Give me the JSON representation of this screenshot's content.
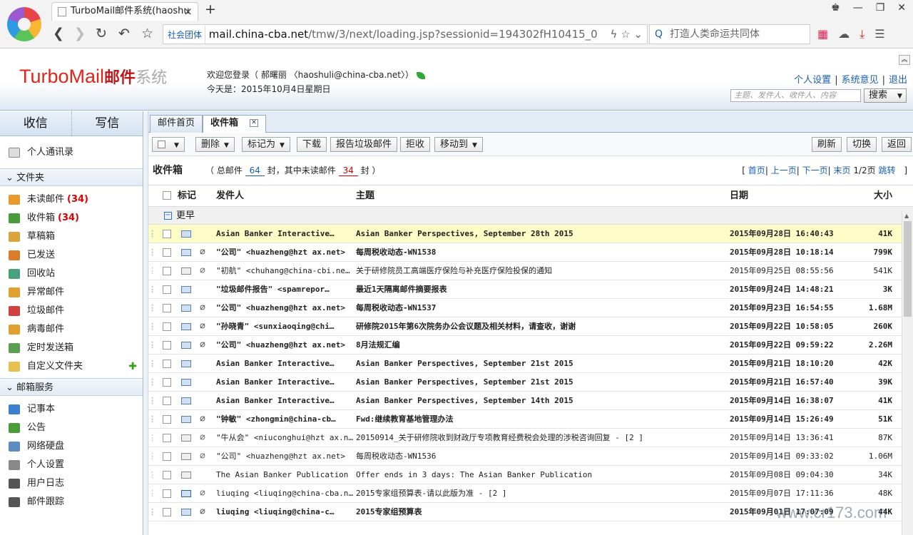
{
  "browser": {
    "tab_title": "TurboMail邮件系统(haoshu",
    "url_tag": "社会团体",
    "url_host": "mail.china-cba.net",
    "url_path": "/tmw/3/next/loading.jsp?sessionid=194302fH10415_0",
    "search_placeholder": "打造人类命运共同体"
  },
  "header": {
    "logo_turbo": "TurboMail",
    "logo_cn": "邮件",
    "logo_gray": "系统",
    "welcome": "欢迎您登录（ 郝曙丽  〈haoshuli@china-cba.net〉）",
    "today": "今天是：2015年10月4日星期日",
    "links": [
      "个人设置",
      "系统意见",
      "退出"
    ],
    "search_placeholder": "主题、发件人、收件人、内容",
    "search_button": "搜索"
  },
  "sidebar": {
    "receive": "收信",
    "compose": "写信",
    "contacts": "个人通讯录",
    "folders_title": "文件夹",
    "folders": [
      {
        "label": "未读邮件",
        "count": "(34)",
        "color": "#e89b2a"
      },
      {
        "label": "收件箱",
        "count": "(34)",
        "color": "#4a9c3a"
      },
      {
        "label": "草稿箱",
        "count": "",
        "color": "#d9a43a"
      },
      {
        "label": "已发送",
        "count": "",
        "color": "#d97d2a"
      },
      {
        "label": "回收站",
        "count": "",
        "color": "#4aa07a"
      },
      {
        "label": "异常邮件",
        "count": "",
        "color": "#e0a030"
      },
      {
        "label": "垃圾邮件",
        "count": "",
        "color": "#d04040"
      },
      {
        "label": "病毒邮件",
        "count": "",
        "color": "#e0a030"
      },
      {
        "label": "定时发送箱",
        "count": "",
        "color": "#5aa050"
      },
      {
        "label": "自定义文件夹",
        "count": "",
        "color": "#e8c050"
      }
    ],
    "services_title": "邮箱服务",
    "services": [
      {
        "label": "记事本",
        "color": "#3b7fd0"
      },
      {
        "label": "公告",
        "color": "#4a9c3a"
      },
      {
        "label": "网络硬盘",
        "color": "#5a8cc0"
      },
      {
        "label": "个人设置",
        "color": "#888888"
      },
      {
        "label": "用户日志",
        "color": "#555555"
      },
      {
        "label": "邮件跟踪",
        "color": "#555555"
      }
    ]
  },
  "main": {
    "tabs": [
      "邮件首页",
      "收件箱"
    ],
    "toolbar": {
      "delete": "删除",
      "mark_as": "标记为",
      "download": "下载",
      "report_spam": "报告垃圾邮件",
      "reject": "拒收",
      "move_to": "移动到",
      "refresh": "刷新",
      "switch": "切换",
      "back": "返回"
    },
    "summary": {
      "title": "收件箱",
      "text_a": "（ 总邮件 ",
      "total": "64",
      "text_b": " 封，其中未读邮件 ",
      "unread": "34",
      "text_c": " 封 ）"
    },
    "pager": {
      "open": "[",
      "first": "首页",
      "prev": "上一页",
      "next": "下一页",
      "last": "末页",
      "page": "1/2页",
      "jump": "跳转",
      "close": "]"
    },
    "columns": {
      "flag": "标记",
      "from": "发件人",
      "subject": "主题",
      "date": "日期",
      "size": "大小"
    },
    "group": "更早",
    "rows": [
      {
        "from": "Asian Banker Interactive…",
        "subject": "Asian Banker Perspectives, September 28th 2015",
        "date": "2015年09月28日 16:40:43",
        "size": "41K",
        "unread": true,
        "attach": false,
        "icon": "unread",
        "selected": true
      },
      {
        "from": "\"公司\" <huazheng@hzt ax.net>",
        "subject": "每周税收动态-WN1538",
        "date": "2015年09月28日 10:18:14",
        "size": "799K",
        "unread": true,
        "attach": true,
        "icon": "unread",
        "selected": false
      },
      {
        "from": "\"初航\" <chuhang@china-cbi.net>",
        "subject": "关于研修院员工高端医疗保险与补充医疗保险投保的通知",
        "date": "2015年09月25日 08:55:56",
        "size": "541K",
        "unread": false,
        "attach": true,
        "icon": "read",
        "selected": false
      },
      {
        "from": "\"垃圾邮件报告\" <spamrepor…",
        "subject": "最近1天隔离邮件摘要报表",
        "date": "2015年09月24日 14:48:21",
        "size": "3K",
        "unread": true,
        "attach": false,
        "icon": "unread",
        "selected": false
      },
      {
        "from": "\"公司\" <huazheng@hzt ax.net>",
        "subject": "每周税收动态-WN1537",
        "date": "2015年09月23日 16:54:55",
        "size": "1.68M",
        "unread": true,
        "attach": true,
        "icon": "unread",
        "selected": false
      },
      {
        "from": "\"孙晓青\" <sunxiaoqing@chi…",
        "subject": "研修院2015年第6次院务办公会议题及相关材料，请查收，谢谢",
        "date": "2015年09月22日 10:58:05",
        "size": "260K",
        "unread": true,
        "attach": true,
        "icon": "unread",
        "selected": false
      },
      {
        "from": "\"公司\" <huazheng@hzt ax.net>",
        "subject": "8月法规汇编",
        "date": "2015年09月22日 09:59:22",
        "size": "2.26M",
        "unread": true,
        "attach": true,
        "icon": "unread",
        "selected": false
      },
      {
        "from": "Asian Banker Interactive…",
        "subject": "Asian Banker Perspectives, September 21st 2015",
        "date": "2015年09月21日 18:10:20",
        "size": "42K",
        "unread": true,
        "attach": false,
        "icon": "unread",
        "selected": false
      },
      {
        "from": "Asian Banker Interactive…",
        "subject": "Asian Banker Perspectives, September 21st 2015",
        "date": "2015年09月21日 16:57:40",
        "size": "39K",
        "unread": true,
        "attach": false,
        "icon": "unread",
        "selected": false
      },
      {
        "from": "Asian Banker Interactive…",
        "subject": "Asian Banker Perspectives, September 14th 2015",
        "date": "2015年09月14日 16:38:07",
        "size": "41K",
        "unread": true,
        "attach": false,
        "icon": "unread",
        "selected": false
      },
      {
        "from": "\"钟敏\" <zhongmin@china-cb…",
        "subject": "Fwd:继续教育基地管理办法",
        "date": "2015年09月14日 15:26:49",
        "size": "51K",
        "unread": true,
        "attach": true,
        "icon": "unread",
        "selected": false
      },
      {
        "from": "\"牛从会\" <niuconghui@hzt ax.net>",
        "subject": "20150914_关于研修院收到财政厅专项教育经费税会处理的涉税咨询回复 - [2 ]",
        "date": "2015年09月14日 13:36:41",
        "size": "87K",
        "unread": false,
        "attach": true,
        "icon": "read",
        "selected": false
      },
      {
        "from": "\"公司\" <huazheng@hzt ax.net>",
        "subject": "每周税收动态-WN1536",
        "date": "2015年09月14日 09:33:02",
        "size": "1.06M",
        "unread": false,
        "attach": true,
        "icon": "read",
        "selected": false
      },
      {
        "from": "The Asian Banker Publication",
        "subject": "Offer ends in 3 days: The Asian Banker Publication",
        "date": "2015年09月08日 09:04:30",
        "size": "34K",
        "unread": false,
        "attach": false,
        "icon": "read",
        "selected": false
      },
      {
        "from": "liuqing <liuqing@china-cba.net>",
        "subject": "2015专家组预算表-请以此版为准 - [2 ]",
        "date": "2015年09月07日 17:11:36",
        "size": "48K",
        "unread": false,
        "attach": true,
        "icon": "reply",
        "selected": false
      },
      {
        "from": "liuqing <liuqing@china-c…",
        "subject": "2015专家组预算表",
        "date": "2015年09月01日 17:07:09",
        "size": "44K",
        "unread": true,
        "attach": true,
        "icon": "unread",
        "selected": false
      }
    ]
  },
  "watermark": "www.cr173.com"
}
